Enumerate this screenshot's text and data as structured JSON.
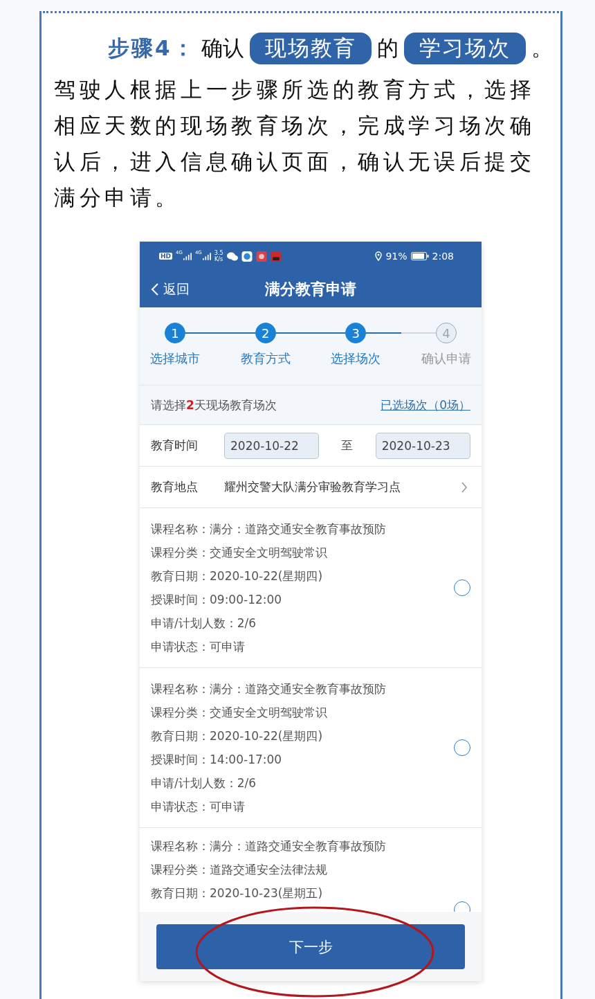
{
  "heading": {
    "label": "步骤4：",
    "parts": [
      {
        "kind": "text",
        "text": "确认"
      },
      {
        "kind": "pill",
        "text": "现场教育"
      },
      {
        "kind": "text",
        "text": "的"
      },
      {
        "kind": "pill",
        "text": "学习场次"
      },
      {
        "kind": "text",
        "text": "。"
      }
    ]
  },
  "paragraph": "驾驶人根据上一步骤所选的教育方式，选择相应天数的现场教育场次，完成学习场次确认后，进入信息确认页面，确认无误后提交满分申请。",
  "phone": {
    "status_bar": {
      "hd": "HD",
      "network": [
        "4G",
        "4G"
      ],
      "speed": "3.5",
      "speed_unit": "K/s",
      "battery_text": "91%",
      "time": "2:08"
    },
    "nav": {
      "back": "返回",
      "title": "满分教育申请"
    },
    "steps": [
      {
        "number": "1",
        "label": "选择城市",
        "active": true
      },
      {
        "number": "2",
        "label": "教育方式",
        "active": true
      },
      {
        "number": "3",
        "label": "选择场次",
        "active": true
      },
      {
        "number": "4",
        "label": "确认申请",
        "active": false
      }
    ],
    "prompt": {
      "text": "请选择**2**天现场教育场次",
      "link": "已选场次（0场）"
    },
    "time_row": {
      "label": "教育时间",
      "start": "2020-10-22",
      "separator": "至",
      "end": "2020-10-23"
    },
    "place_row": {
      "label": "教育地点",
      "value": "耀州交警大队满分审验教育学习点"
    },
    "sessions": [
      {
        "selected": false,
        "lines": [
          "课程名称：满分：道路交通安全教育事故预防",
          "课程分类：交通安全文明驾驶常识",
          "教育日期：2020-10-22(星期四)",
          "授课时间：09:00-12:00",
          "申请/计划人数：2/6",
          "申请状态：可申请"
        ]
      },
      {
        "selected": false,
        "lines": [
          "课程名称：满分：道路交通安全教育事故预防",
          "课程分类：交通安全文明驾驶常识",
          "教育日期：2020-10-22(星期四)",
          "授课时间：14:00-17:00",
          "申请/计划人数：2/6",
          "申请状态：可申请"
        ]
      },
      {
        "selected": false,
        "lines": [
          "课程名称：满分：道路交通安全教育事故预防",
          "课程分类：道路交通安全法律法规",
          "教育日期：2020-10-23(星期五)"
        ]
      }
    ],
    "next_button": "下一步"
  }
}
